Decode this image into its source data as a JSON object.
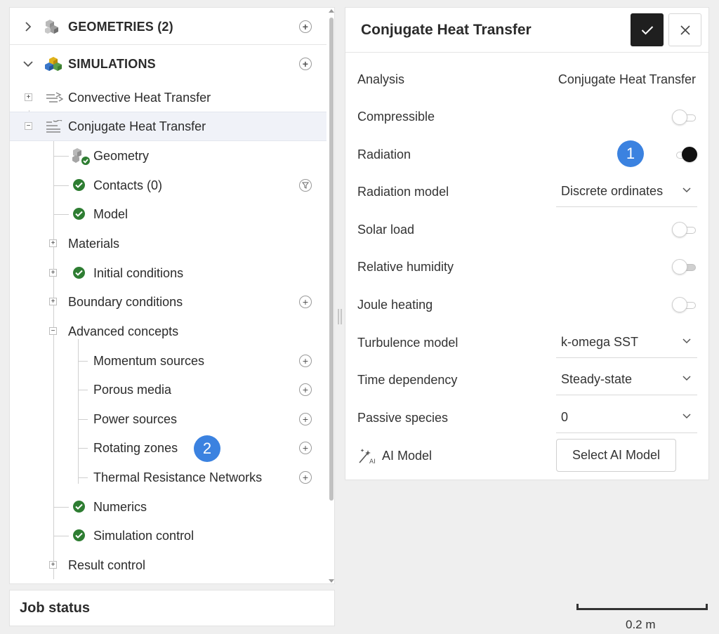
{
  "tree": {
    "geometries_label": "GEOMETRIES (2)",
    "simulations_label": "SIMULATIONS",
    "convective": "Convective Heat Transfer",
    "conjugate": "Conjugate Heat Transfer",
    "geometry": "Geometry",
    "contacts": "Contacts (0)",
    "model": "Model",
    "materials": "Materials",
    "initial_conditions": "Initial conditions",
    "boundary_conditions": "Boundary conditions",
    "advanced_concepts": "Advanced concepts",
    "momentum_sources": "Momentum sources",
    "porous_media": "Porous media",
    "power_sources": "Power sources",
    "rotating_zones": "Rotating zones",
    "thermal_resistance": "Thermal Resistance Networks",
    "numerics": "Numerics",
    "simulation_control": "Simulation control",
    "result_control": "Result control"
  },
  "job_status": "Job status",
  "props": {
    "title": "Conjugate Heat Transfer",
    "analysis_label": "Analysis",
    "analysis_value": "Conjugate Heat Transfer",
    "compressible_label": "Compressible",
    "radiation_label": "Radiation",
    "radiation_model_label": "Radiation model",
    "radiation_model_value": "Discrete ordinates",
    "solar_load_label": "Solar load",
    "relative_humidity_label": "Relative humidity",
    "joule_heating_label": "Joule heating",
    "turbulence_label": "Turbulence model",
    "turbulence_value": "k-omega SST",
    "time_dependency_label": "Time dependency",
    "time_dependency_value": "Steady-state",
    "passive_species_label": "Passive species",
    "passive_species_value": "0",
    "ai_model_label": "AI Model",
    "select_ai_button": "Select AI Model"
  },
  "badges": {
    "one": "1",
    "two": "2"
  },
  "scale_bar": "0.2 m",
  "colors": {
    "check_green": "#2e7d32",
    "badge_blue": "#3b82e0",
    "confirm_dark": "#1f1f1f"
  }
}
